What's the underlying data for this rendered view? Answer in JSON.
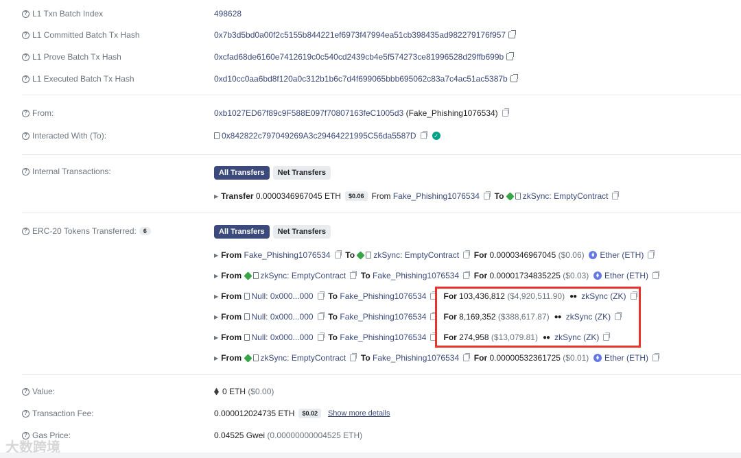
{
  "batch": {
    "index_label": "L1 Txn Batch Index",
    "index_value": "498628",
    "committed_label": "L1 Committed Batch Tx Hash",
    "committed_value": "0x7b3d5bd0a00f2c5155b844221ef6973f47994ea51cb398435ad982279176f957",
    "prove_label": "L1 Prove Batch Tx Hash",
    "prove_value": "0xcfad68de6160e7412619c0c540cd2439cb4e5f574273ce81996528d29ffb699b",
    "executed_label": "L1 Executed Batch Tx Hash",
    "executed_value": "0xd10cc0aa6bd8f120a0c312b1b6c7d4f699065bbb695062c83a7c4ac51ac5387b"
  },
  "from": {
    "label": "From:",
    "address": "0xb1027ED67f89c9F588E097f70807163feC1005d3",
    "name": "(Fake_Phishing1076534)"
  },
  "to": {
    "label": "Interacted With (To):",
    "address": "0x842822c797049269A3c29464221995C56da5587D"
  },
  "internal": {
    "label": "Internal Transactions:",
    "tab_all": "All Transfers",
    "tab_net": "Net Transfers",
    "transfer_word": "Transfer",
    "amount": "0.0000346967045 ETH",
    "usd": "$0.06",
    "from_word": "From",
    "from_name": "Fake_Phishing1076534",
    "to_word": "To",
    "to_name": "zkSync: EmptyContract"
  },
  "erc20": {
    "label": "ERC-20 Tokens Transferred:",
    "count": "6",
    "tab_all": "All Transfers",
    "tab_net": "Net Transfers",
    "from_word": "From",
    "to_word": "To",
    "for_word": "For",
    "rows": [
      {
        "from": "Fake_Phishing1076534",
        "to": "zkSync: EmptyContract",
        "amount": "0.0000346967045",
        "usd": "($0.06)",
        "token": "Ether (ETH)"
      },
      {
        "from": "zkSync: EmptyContract",
        "to": "Fake_Phishing1076534",
        "amount": "0.00001734835225",
        "usd": "($0.03)",
        "token": "Ether (ETH)"
      },
      {
        "from": "Null: 0x000...000",
        "to": "Fake_Phishing1076534",
        "amount": "103,436,812",
        "usd": "($4,920,511.90)",
        "token": "zkSync (ZK)"
      },
      {
        "from": "Null: 0x000...000",
        "to": "Fake_Phishing1076534",
        "amount": "8,169,352",
        "usd": "($388,617.87)",
        "token": "zkSync (ZK)"
      },
      {
        "from": "Null: 0x000...000",
        "to": "Fake_Phishing1076534",
        "amount": "274,958",
        "usd": "($13,079.81)",
        "token": "zkSync (ZK)"
      },
      {
        "from": "zkSync: EmptyContract",
        "to": "Fake_Phishing1076534",
        "amount": "0.00000532361725",
        "usd": "($0.01)",
        "token": "Ether (ETH)"
      }
    ]
  },
  "value": {
    "label": "Value:",
    "eth": "0 ETH",
    "usd": "($0.00)"
  },
  "fee": {
    "label": "Transaction Fee:",
    "eth": "0.000012024735 ETH",
    "usd": "$0.02",
    "more": "Show more details"
  },
  "gas": {
    "label": "Gas Price:",
    "gwei": "0.04525 Gwei",
    "eth": "(0.00000000004525 ETH)"
  },
  "watermark": "大数跨境"
}
